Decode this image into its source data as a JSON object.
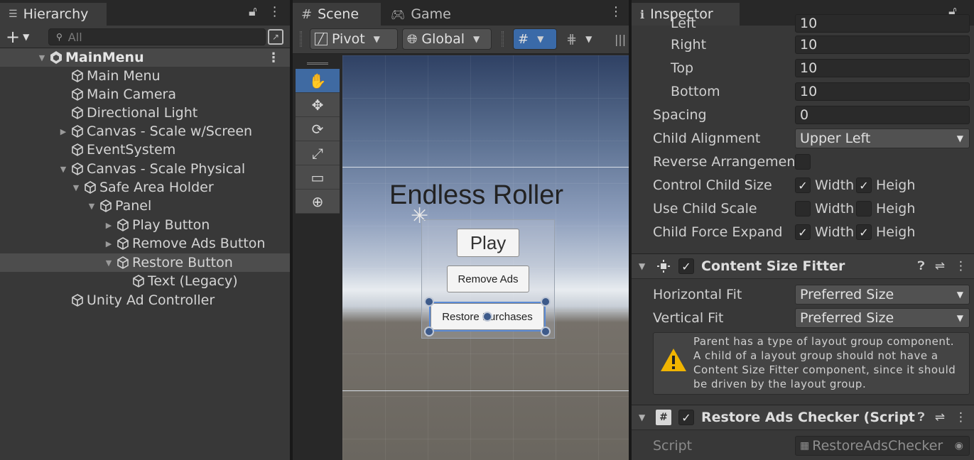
{
  "hierarchy": {
    "tab_label": "Hierarchy",
    "search_placeholder": "All",
    "add_label": "+",
    "scene_name": "MainMenu",
    "items": [
      {
        "label": "Main Menu"
      },
      {
        "label": "Main Camera"
      },
      {
        "label": "Directional Light"
      },
      {
        "label": "Canvas - Scale w/Screen"
      },
      {
        "label": "EventSystem"
      },
      {
        "label": "Canvas - Scale Physical"
      },
      {
        "label": "Safe Area Holder"
      },
      {
        "label": "Panel"
      },
      {
        "label": "Play Button"
      },
      {
        "label": "Remove Ads Button"
      },
      {
        "label": "Restore Button"
      },
      {
        "label": "Text (Legacy)"
      },
      {
        "label": "Unity Ad Controller"
      }
    ]
  },
  "scene": {
    "tabs": [
      {
        "label": "Scene"
      },
      {
        "label": "Game"
      }
    ],
    "toolbar": {
      "pivot": "Pivot",
      "global": "Global"
    },
    "canvas": {
      "title": "Endless Roller",
      "play": "Play",
      "remove_ads": "Remove Ads",
      "restore": "Restore Purchases"
    }
  },
  "inspector": {
    "tab_label": "Inspector",
    "padding": {
      "left_label": "Left",
      "left_value": "10",
      "right_label": "Right",
      "right_value": "10",
      "top_label": "Top",
      "top_value": "10",
      "bottom_label": "Bottom",
      "bottom_value": "10"
    },
    "spacing": {
      "label": "Spacing",
      "value": "0"
    },
    "child_alignment": {
      "label": "Child Alignment",
      "value": "Upper Left"
    },
    "reverse_arrangement": {
      "label": "Reverse Arrangement",
      "checked": false
    },
    "control_child_size": {
      "label": "Control Child Size",
      "width": "Width",
      "height": "Heigh",
      "width_checked": true,
      "height_checked": true
    },
    "use_child_scale": {
      "label": "Use Child Scale",
      "width": "Width",
      "height": "Heigh",
      "width_checked": false,
      "height_checked": false
    },
    "child_force_expand": {
      "label": "Child Force Expand",
      "width": "Width",
      "height": "Heigh",
      "width_checked": true,
      "height_checked": true
    },
    "content_size_fitter": {
      "title": "Content Size Fitter",
      "horizontal_fit_label": "Horizontal Fit",
      "horizontal_fit_value": "Preferred Size",
      "vertical_fit_label": "Vertical Fit",
      "vertical_fit_value": "Preferred Size",
      "warning": "Parent has a type of layout group component. A child of a layout group should not have a Content Size Fitter component, since it should be driven by the layout group."
    },
    "restore_ads_checker": {
      "title": "Restore Ads Checker (Script",
      "script_label": "Script",
      "script_value": "RestoreAdsChecker"
    }
  },
  "colors": {
    "selection_blue": "#3f6aa2",
    "panel_bg": "#383838",
    "tab_bg": "#282828"
  }
}
